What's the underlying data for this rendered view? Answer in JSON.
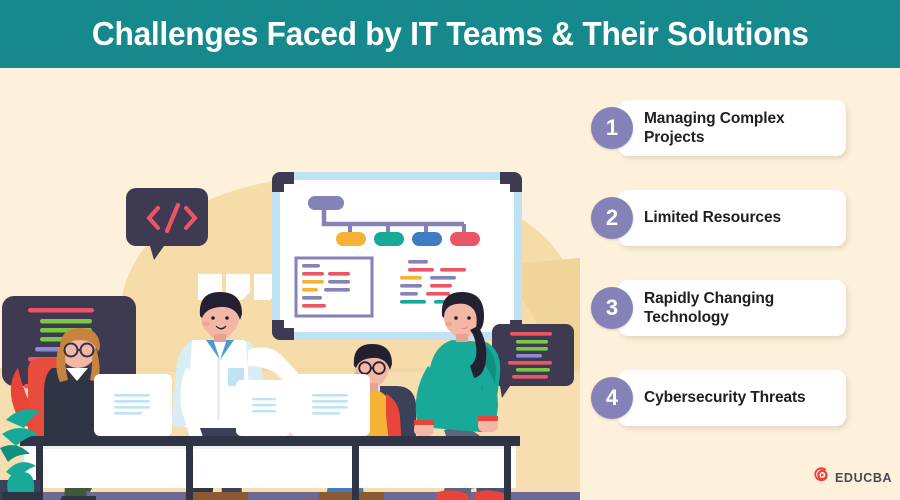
{
  "header": {
    "title": "Challenges Faced by IT Teams & Their Solutions"
  },
  "colors": {
    "header_teal": "#15898C",
    "background_cream": "#FDF1DC",
    "blob_tan": "#F5DCA8",
    "number_purple": "#8582B8",
    "card_white": "#FFFFFF",
    "text_dark": "#1F1F22",
    "logo_red": "#E8443A",
    "code_navy": "#3E3A52",
    "accent_yellow": "#F5B335",
    "accent_teal": "#18A999",
    "accent_blue": "#3E7CC4",
    "accent_red": "#ED5565",
    "floor_purple": "#6E6A96"
  },
  "list": {
    "items": [
      {
        "number": "1",
        "label": "Managing Complex Projects"
      },
      {
        "number": "2",
        "label": "Limited Resources"
      },
      {
        "number": "3",
        "label": "Rapidly Changing Technology"
      },
      {
        "number": "4",
        "label": "Cybersecurity Threats"
      }
    ]
  },
  "illustration": {
    "alt": "Flat illustration of an IT team in an office: a presenter pointing at a whiteboard flowchart, two colleagues at desktop monitors, a standing woman, code speech bubbles and sticky notes",
    "code_bubble_symbol": "</>",
    "whiteboard": {
      "flowchart_nodes": [
        "root",
        "yellow",
        "teal",
        "blue",
        "red"
      ]
    },
    "sticky_notes_count": 3
  },
  "logo": {
    "text": "EDUCBA",
    "icon": "educba-play-circle-icon"
  }
}
